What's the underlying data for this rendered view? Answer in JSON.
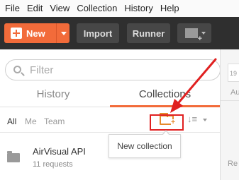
{
  "menu": [
    "File",
    "Edit",
    "View",
    "Collection",
    "History",
    "Help"
  ],
  "toolbar": {
    "new_label": "New",
    "import_label": "Import",
    "runner_label": "Runner"
  },
  "search": {
    "placeholder": "Filter"
  },
  "tabs": {
    "history": "History",
    "collections": "Collections"
  },
  "filters": {
    "all": "All",
    "me": "Me",
    "team": "Team"
  },
  "collection": {
    "name": "AirVisual API",
    "count": "11 requests"
  },
  "tooltip": "New collection",
  "right_pane": {
    "box_text": "19",
    "label_au": "Au",
    "label_re": "Re"
  },
  "colors": {
    "accent": "#f26b3a",
    "highlight": "#e02020",
    "toolbar": "#2f2f2f"
  },
  "icons": [
    "plus-icon",
    "chevron-down-icon",
    "new-window-icon",
    "search-icon",
    "new-folder-icon",
    "sort-icon",
    "folder-icon",
    "arrow-annotation"
  ]
}
